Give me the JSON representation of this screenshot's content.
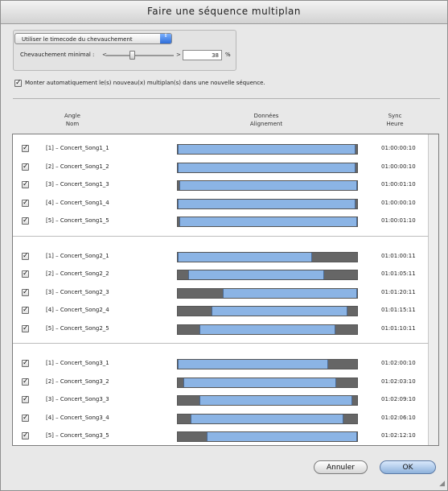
{
  "window": {
    "title": "Faire une séquence multiplan"
  },
  "sync_mode": {
    "selected": "Utiliser le timecode du chevauchement",
    "arrows": "⇕"
  },
  "overlap": {
    "label": "Chevauchement minimal :",
    "min_glyph": "<",
    "max_glyph": ">",
    "value": "38",
    "unit": "%",
    "slider_fraction": 0.38
  },
  "auto_edit": {
    "checked": true,
    "label": "Monter automatiquement le(s) nouveau(x) multiplan(s) dans une nouvelle séquence."
  },
  "columns": {
    "angle": "Angle",
    "name": "Nom",
    "data": "Données",
    "alignment": "Alignement",
    "sync": "Sync",
    "time": "Heure"
  },
  "groups": [
    {
      "rows": [
        {
          "checked": true,
          "name": "[1] – Concert_Song1_1",
          "time": "01:00:00:10",
          "fill_start": 0.0,
          "fill_end": 0.99
        },
        {
          "checked": true,
          "name": "[2] – Concert_Song1_2",
          "time": "01:00:00:10",
          "fill_start": 0.0,
          "fill_end": 0.99
        },
        {
          "checked": true,
          "name": "[3] – Concert_Song1_3",
          "time": "01:00:01:10",
          "fill_start": 0.01,
          "fill_end": 1.0
        },
        {
          "checked": true,
          "name": "[4] – Concert_Song1_4",
          "time": "01:00:00:10",
          "fill_start": 0.0,
          "fill_end": 0.99
        },
        {
          "checked": true,
          "name": "[5] – Concert_Song1_5",
          "time": "01:00:01:10",
          "fill_start": 0.01,
          "fill_end": 1.0
        }
      ]
    },
    {
      "rows": [
        {
          "checked": true,
          "name": "[1] – Concert_Song2_1",
          "time": "01:01:00:11",
          "fill_start": 0.0,
          "fill_end": 0.75
        },
        {
          "checked": true,
          "name": "[2] – Concert_Song2_2",
          "time": "01:01:05:11",
          "fill_start": 0.06,
          "fill_end": 0.82
        },
        {
          "checked": true,
          "name": "[3] – Concert_Song2_3",
          "time": "01:01:20:11",
          "fill_start": 0.25,
          "fill_end": 1.0
        },
        {
          "checked": true,
          "name": "[4] – Concert_Song2_4",
          "time": "01:01:15:11",
          "fill_start": 0.19,
          "fill_end": 0.95
        },
        {
          "checked": true,
          "name": "[5] – Concert_Song2_5",
          "time": "01:01:10:11",
          "fill_start": 0.12,
          "fill_end": 0.88
        }
      ]
    },
    {
      "rows": [
        {
          "checked": true,
          "name": "[1] – Concert_Song3_1",
          "time": "01:02:00:10",
          "fill_start": 0.0,
          "fill_end": 0.84
        },
        {
          "checked": true,
          "name": "[2] – Concert_Song3_2",
          "time": "01:02:03:10",
          "fill_start": 0.03,
          "fill_end": 0.88
        },
        {
          "checked": true,
          "name": "[3] – Concert_Song3_3",
          "time": "01:02:09:10",
          "fill_start": 0.12,
          "fill_end": 0.97
        },
        {
          "checked": true,
          "name": "[4] – Concert_Song3_4",
          "time": "01:02:06:10",
          "fill_start": 0.07,
          "fill_end": 0.92
        },
        {
          "checked": true,
          "name": "[5] – Concert_Song3_5",
          "time": "01:02:12:10",
          "fill_start": 0.16,
          "fill_end": 1.0
        }
      ]
    }
  ],
  "buttons": {
    "cancel": "Annuler",
    "ok": "OK"
  },
  "colors": {
    "bar_fill": "#8bb4e5",
    "bar_empty": "#666666",
    "default_button": "#8fb2dc"
  }
}
